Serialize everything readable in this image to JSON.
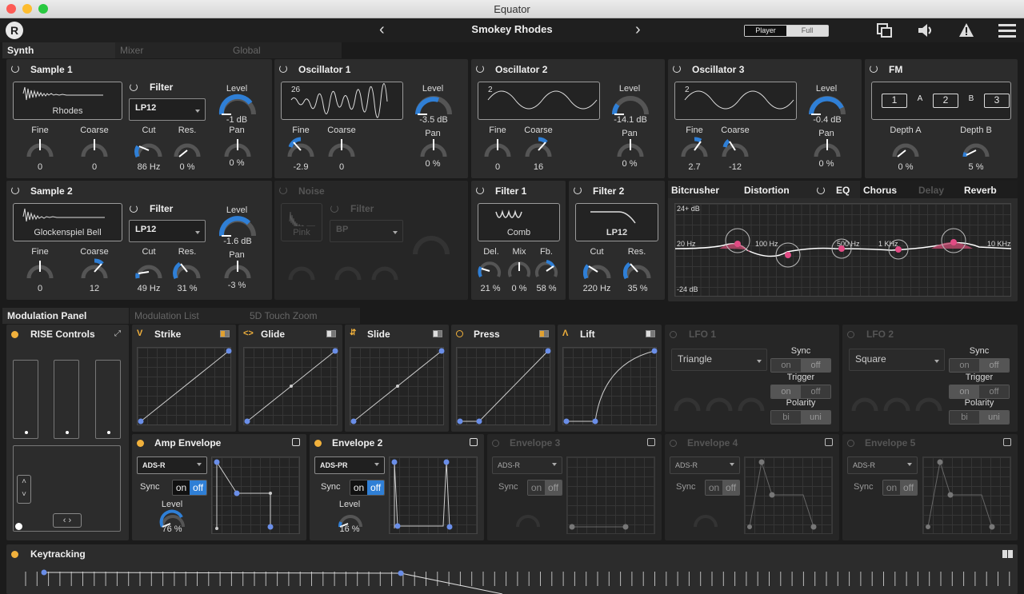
{
  "window": {
    "title": "Equator"
  },
  "toolbar": {
    "preset": "Smokey Rhodes",
    "mode_player": "Player",
    "mode_full": "Full"
  },
  "top_tabs": [
    "Synth",
    "Mixer",
    "Global"
  ],
  "sample1": {
    "title": "Sample 1",
    "wave": "Rhodes",
    "filter_label": "Filter",
    "filter": "LP12",
    "level_label": "Level",
    "level": "-1 dB",
    "pan_label": "Pan",
    "pan": "0 %",
    "fine_label": "Fine",
    "fine": "0",
    "coarse_label": "Coarse",
    "coarse": "0",
    "cut_label": "Cut",
    "cut": "86 Hz",
    "res_label": "Res.",
    "res": "0 %",
    "level_frac": 0.72
  },
  "sample2": {
    "title": "Sample 2",
    "wave": "Glockenspiel Bell",
    "filter_label": "Filter",
    "filter": "LP12",
    "level_label": "Level",
    "level": "-1.6 dB",
    "pan_label": "Pan",
    "pan": "-3 %",
    "fine_label": "Fine",
    "fine": "0",
    "coarse_label": "Coarse",
    "coarse": "12",
    "cut_label": "Cut",
    "cut": "49 Hz",
    "res_label": "Res.",
    "res": "31 %",
    "level_frac": 0.68
  },
  "osc1": {
    "title": "Oscillator 1",
    "wave_num": "26",
    "level_label": "Level",
    "level": "-3.5 dB",
    "pan_label": "Pan",
    "pan": "0 %",
    "fine_label": "Fine",
    "fine": "-2.9",
    "coarse_label": "Coarse",
    "coarse": "0",
    "level_frac": 0.6
  },
  "osc2": {
    "title": "Oscillator 2",
    "wave_num": "2",
    "level_label": "Level",
    "level": "-14.1 dB",
    "pan_label": "Pan",
    "pan": "0 %",
    "fine_label": "Fine",
    "fine": "0",
    "coarse_label": "Coarse",
    "coarse": "16",
    "level_frac": 0.3
  },
  "osc3": {
    "title": "Oscillator 3",
    "wave_num": "2",
    "level_label": "Level",
    "level": "-0.4 dB",
    "pan_label": "Pan",
    "pan": "0 %",
    "fine_label": "Fine",
    "fine": "2.7",
    "coarse_label": "Coarse",
    "coarse": "-12",
    "level_frac": 0.8
  },
  "fm": {
    "title": "FM",
    "n1": "1",
    "n2": "2",
    "n3": "3",
    "a": "A",
    "b": "B",
    "depth_a_label": "Depth A",
    "depth_a": "0 %",
    "depth_b_label": "Depth B",
    "depth_b": "5 %"
  },
  "noise": {
    "title": "Noise",
    "color": "Pink",
    "filter_label": "Filter",
    "filter": "BP"
  },
  "filter1": {
    "title": "Filter 1",
    "type": "Comb",
    "del_label": "Del.",
    "del": "21 %",
    "mix_label": "Mix",
    "mix": "0 %",
    "fb_label": "Fb.",
    "fb": "58 %"
  },
  "filter2": {
    "title": "Filter 2",
    "type": "LP12",
    "cut_label": "Cut",
    "cut": "220 Hz",
    "res_label": "Res.",
    "res": "35 %"
  },
  "fx": {
    "tabs": [
      "Bitcrusher",
      "Distortion",
      "EQ",
      "Chorus",
      "Delay",
      "Reverb"
    ],
    "top": "24+ dB",
    "bottom": "-24 dB",
    "f20": "20 Hz",
    "f100": "100 Hz",
    "f500": "500 Hz",
    "f1k": "1 KHz",
    "f10k": "10 KHz"
  },
  "mod_tabs": [
    "Modulation Panel",
    "Modulation List",
    "5D Touch Zoom"
  ],
  "rise": {
    "title": "RISE Controls"
  },
  "mod": {
    "strike": "Strike",
    "glide": "Glide",
    "slide": "Slide",
    "press": "Press",
    "lift": "Lift"
  },
  "lfo1": {
    "title": "LFO 1",
    "wave": "Triangle",
    "sync": "Sync",
    "trigger": "Trigger",
    "polarity": "Polarity",
    "on": "on",
    "off": "off",
    "bi": "bi",
    "uni": "uni"
  },
  "lfo2": {
    "title": "LFO 2",
    "wave": "Square",
    "sync": "Sync",
    "trigger": "Trigger",
    "polarity": "Polarity",
    "on": "on",
    "off": "off",
    "bi": "bi",
    "uni": "uni"
  },
  "env": {
    "amp": "Amp Envelope",
    "e2": "Envelope 2",
    "e3": "Envelope 3",
    "e4": "Envelope 4",
    "e5": "Envelope 5",
    "adsr": "ADS-R",
    "adspr": "ADS-PR",
    "sync": "Sync",
    "on": "on",
    "off": "off",
    "level_label": "Level",
    "amp_level": "76 %",
    "e2_level": "16 %"
  },
  "keytracking": {
    "title": "Keytracking"
  }
}
